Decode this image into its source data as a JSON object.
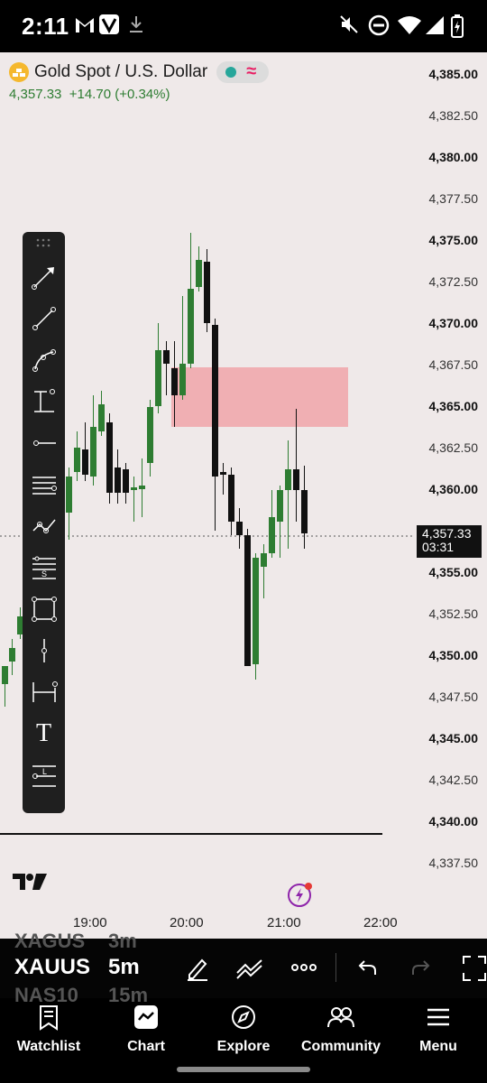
{
  "status_bar": {
    "time": "2:11",
    "icons": [
      "gmail-icon",
      "v-app-icon",
      "download-icon",
      "mute-icon",
      "dnd-icon",
      "wifi-icon",
      "signal-icon",
      "battery-charging-icon"
    ]
  },
  "symbol": {
    "name": "Gold Spot / U.S. Dollar",
    "price": "4,357.33",
    "change": "+14.70 (+0.34%)",
    "icon": "gold-bars-icon"
  },
  "price_axis": {
    "labels": [
      "4,385.00",
      "4,382.50",
      "4,380.00",
      "4,377.50",
      "4,375.00",
      "4,372.50",
      "4,370.00",
      "4,367.50",
      "4,365.00",
      "4,362.50",
      "4,360.00",
      "4,355.00",
      "4,352.50",
      "4,350.00",
      "4,347.50",
      "4,345.00",
      "4,342.50",
      "4,340.00",
      "4,337.50"
    ],
    "current_price": "4,357.33",
    "countdown": "03:31"
  },
  "time_axis": {
    "labels": [
      "19:00",
      "20:00",
      "21:00",
      "22:00"
    ]
  },
  "drawing_tools": [
    "trend-line-arrow",
    "trend-line",
    "curve",
    "vertical-measure",
    "horizontal-ray",
    "parallel-lines",
    "polyline",
    "fib-s",
    "rectangle",
    "vertical-line",
    "date-range",
    "text",
    "fib-l"
  ],
  "text_tool_label": "T",
  "bottom_toolbar": {
    "symbol": "XAUUS",
    "timeframe": "5m",
    "prev_symbol": "XAGUS",
    "prev_timeframe": "3m",
    "next_symbol": "NAS10",
    "next_timeframe": "15m"
  },
  "nav": [
    {
      "label": "Watchlist",
      "icon": "watchlist-icon"
    },
    {
      "label": "Chart",
      "icon": "chart-icon"
    },
    {
      "label": "Explore",
      "icon": "compass-icon"
    },
    {
      "label": "Community",
      "icon": "people-icon"
    },
    {
      "label": "Menu",
      "icon": "menu-icon"
    }
  ],
  "colors": {
    "up": "#2e7d32",
    "down": "#111111",
    "zone": "#f0a8ad",
    "bg": "#efe9e9"
  }
}
